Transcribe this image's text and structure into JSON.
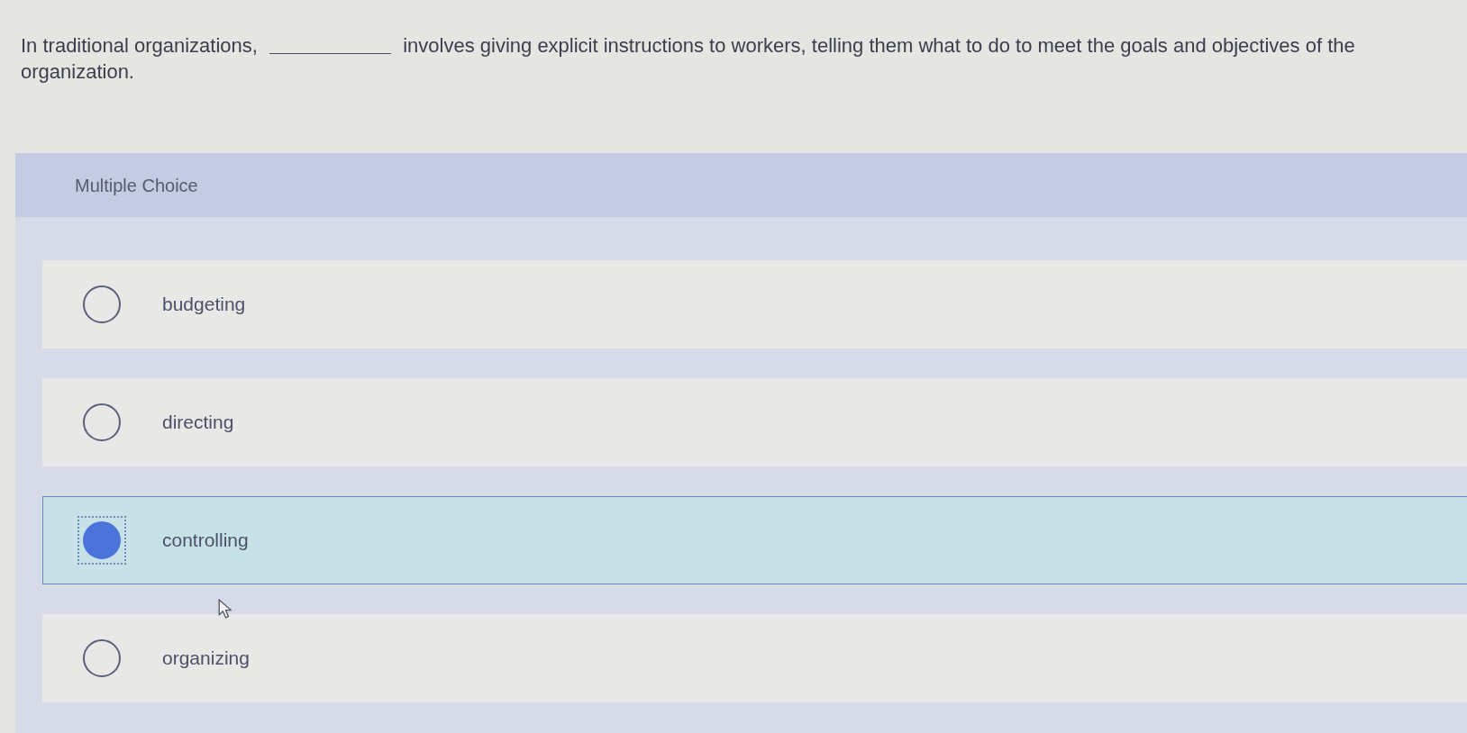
{
  "question": {
    "parts": [
      {
        "kind": "text",
        "text": "In traditional organizations,"
      },
      {
        "kind": "blank"
      },
      {
        "kind": "text",
        "text": "involves giving explicit instructions to workers, telling them what to do to meet the goals and objectives of the organization."
      }
    ]
  },
  "panel": {
    "title": "Multiple Choice"
  },
  "options": [
    {
      "label": "budgeting",
      "selected": false,
      "focused": false
    },
    {
      "label": "directing",
      "selected": false,
      "focused": false
    },
    {
      "label": "controlling",
      "selected": true,
      "focused": true
    },
    {
      "label": "organizing",
      "selected": false,
      "focused": false
    }
  ]
}
